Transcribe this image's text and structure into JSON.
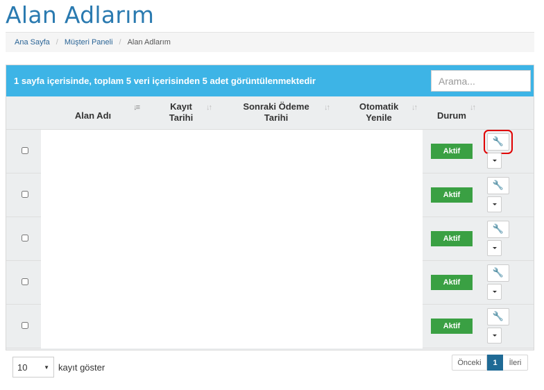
{
  "page": {
    "title": "Alan Adlarım"
  },
  "breadcrumb": [
    "Ana Sayfa",
    "Müşteri Paneli",
    "Alan Adlarım"
  ],
  "table_info": "1 sayfa içerisinde, toplam 5 veri içerisinden 5 adet görüntülenmektedir",
  "search": {
    "placeholder": "Arama..."
  },
  "columns": {
    "domain": "Alan Adı",
    "reg_date": "Kayıt\nTarihi",
    "next_due": "Sonraki Ödeme\nTarihi",
    "auto_renew": "Otomatik\nYenile",
    "status": "Durum"
  },
  "rows": [
    {
      "status": "Aktif"
    },
    {
      "status": "Aktif"
    },
    {
      "status": "Aktif"
    },
    {
      "status": "Aktif"
    },
    {
      "status": "Aktif"
    }
  ],
  "length": {
    "value": "10",
    "label": "kayıt göster"
  },
  "pagination": {
    "prev": "Önceki",
    "current": "1",
    "next": "İleri"
  },
  "colors": {
    "title": "#2a7ab0",
    "header_bar": "#3db4e6",
    "badge": "#3aa043",
    "page_active": "#1f6a95",
    "highlight": "#e00000"
  }
}
